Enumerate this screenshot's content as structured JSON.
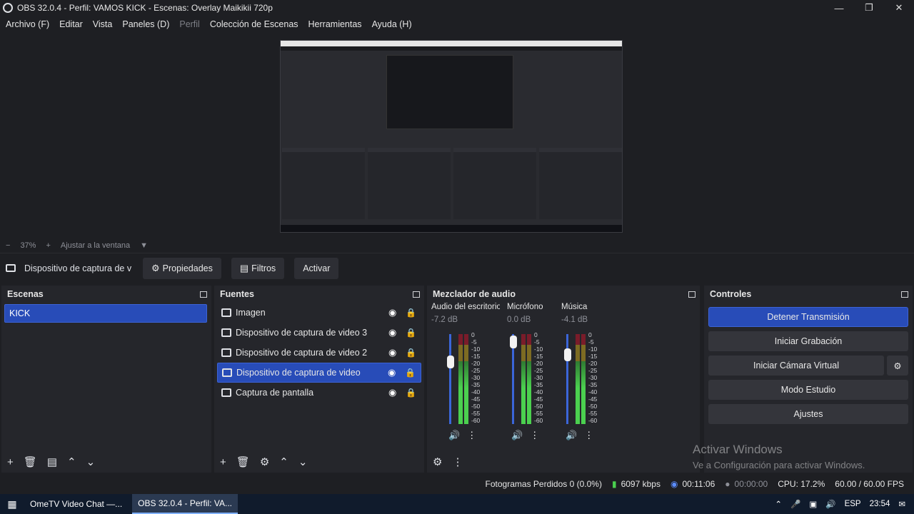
{
  "window": {
    "title": "OBS 32.0.4 - Perfil: VAMOS KICK - Escenas: Overlay Maikikii 720p"
  },
  "menu": [
    {
      "label": "Archivo (F)",
      "dim": false
    },
    {
      "label": "Editar",
      "dim": false
    },
    {
      "label": "Vista",
      "dim": false
    },
    {
      "label": "Paneles (D)",
      "dim": false
    },
    {
      "label": "Perfil",
      "dim": true
    },
    {
      "label": "Colección de Escenas",
      "dim": false
    },
    {
      "label": "Herramientas",
      "dim": false
    },
    {
      "label": "Ayuda (H)",
      "dim": false
    }
  ],
  "zoom": {
    "minus": "−",
    "value": "37%",
    "plus": "+",
    "fit_label": "Ajustar a la ventana"
  },
  "context": {
    "source_name": "Dispositivo de captura de v",
    "properties_label": "Propiedades",
    "filters_label": "Filtros",
    "activate_label": "Activar"
  },
  "scenes": {
    "title": "Escenas",
    "items": [
      "KICK"
    ]
  },
  "sources": {
    "title": "Fuentes",
    "items": [
      {
        "label": "Imagen",
        "icon": "image-icon",
        "selected": false
      },
      {
        "label": "Dispositivo de captura de video 3",
        "icon": "camera-icon",
        "selected": false
      },
      {
        "label": "Dispositivo de captura de video 2",
        "icon": "camera-icon",
        "selected": false
      },
      {
        "label": "Dispositivo de captura de video",
        "icon": "camera-icon",
        "selected": true
      },
      {
        "label": "Captura de pantalla",
        "icon": "monitor-icon",
        "selected": false
      }
    ]
  },
  "mixer": {
    "title": "Mezclador de audio",
    "scale": [
      "0",
      "-5",
      "-10",
      "-15",
      "-20",
      "-25",
      "-30",
      "-35",
      "-40",
      "-45",
      "-50",
      "-55",
      "-60"
    ],
    "channels": [
      {
        "name": "Audio del escritorio",
        "db": "-7.2 dB",
        "level": 0.75
      },
      {
        "name": "Micrófono",
        "db": "0.0 dB",
        "level": 1.0
      },
      {
        "name": "Música",
        "db": "-4.1 dB",
        "level": 0.84
      }
    ]
  },
  "controls": {
    "title": "Controles",
    "stop_stream": "Detener Transmisión",
    "start_recording": "Iniciar Grabación",
    "start_virtual_cam": "Iniciar Cámara Virtual",
    "studio_mode": "Modo Estudio",
    "settings": "Ajustes"
  },
  "watermark": {
    "line1": "Activar Windows",
    "line2": "Ve a Configuración para activar Windows."
  },
  "status": {
    "dropped_frames": "Fotogramas Perdidos 0 (0.0%)",
    "bitrate": "6097 kbps",
    "stream_time": "00:11:06",
    "record_time": "00:00:00",
    "cpu": "CPU: 17.2%",
    "fps": "60.00 / 60.00 FPS"
  },
  "taskbar": {
    "tasks": [
      {
        "label": "OmeTV Video Chat —...",
        "active": false
      },
      {
        "label": "OBS 32.0.4 - Perfil: VA...",
        "active": true
      }
    ],
    "lang": "ESP",
    "clock": "23:54"
  },
  "colors": {
    "accent": "#284cb8",
    "panel": "#25262b",
    "bg": "#1e1f23"
  }
}
